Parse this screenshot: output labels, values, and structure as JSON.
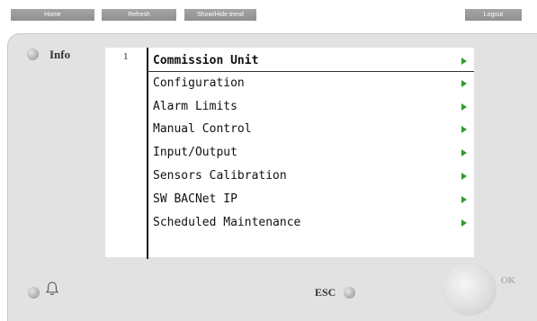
{
  "topbar": {
    "home": "Home",
    "refresh": "Refresh",
    "show_hide_trend": "Show/Hide trend",
    "logout": "Logout"
  },
  "panel": {
    "info_label": "Info",
    "esc_label": "ESC",
    "ok_label": "OK"
  },
  "screen": {
    "row_number": "1",
    "menu_items": [
      "Commission Unit",
      "Configuration",
      "Alarm Limits",
      "Manual Control",
      "Input/Output",
      "Sensors Calibration",
      "SW BACNet IP",
      "Scheduled Maintenance"
    ]
  },
  "icons": {
    "alarm": "bell-icon",
    "menu_arrow": "green-triangle-right-icon"
  },
  "colors": {
    "arrow": "#2e9e2e",
    "button": "#9b9b9b",
    "panel": "#e2e2e2"
  }
}
